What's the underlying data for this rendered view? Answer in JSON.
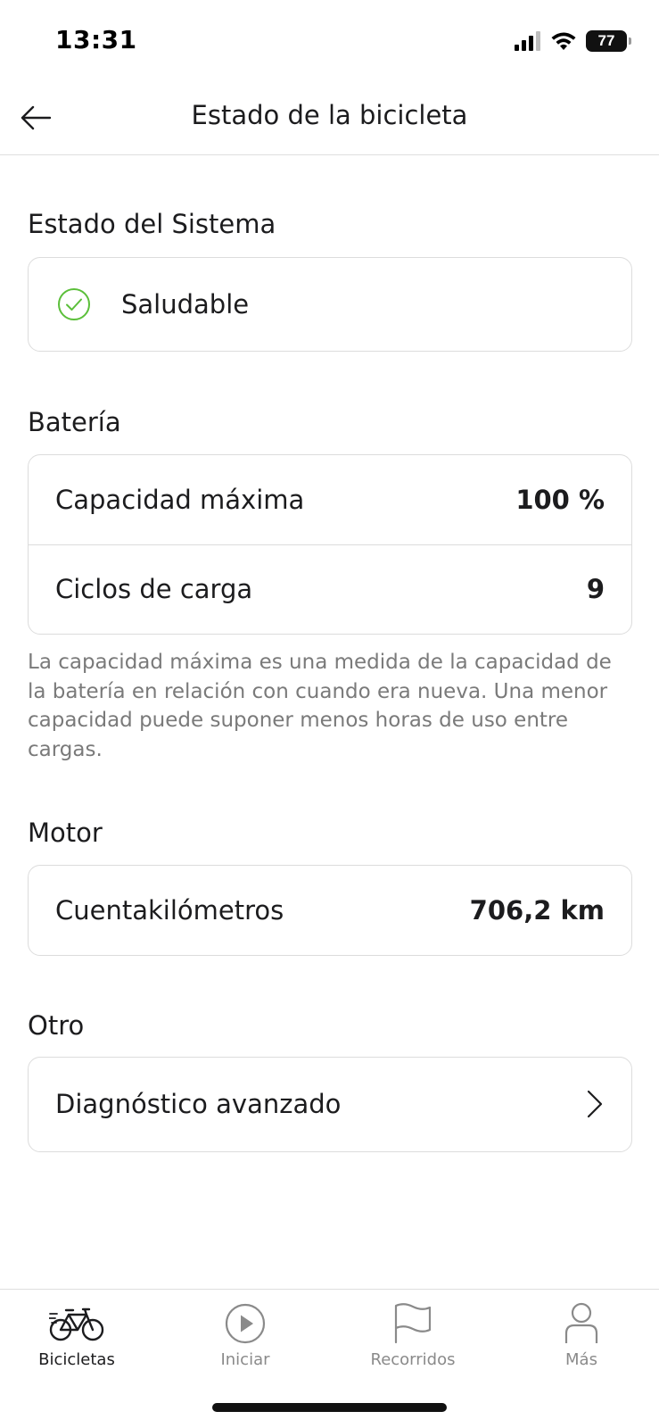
{
  "status_bar": {
    "time": "13:31",
    "battery_level": "77",
    "icons": [
      "cellular-signal-icon",
      "wifi-icon",
      "battery-icon"
    ]
  },
  "header": {
    "title": "Estado de la bicicleta",
    "back_icon": "arrow-left-icon"
  },
  "system": {
    "section_title": "Estado del Sistema",
    "status_label": "Saludable",
    "status_icon": "check-circle-icon",
    "status_color": "#5bbf3a"
  },
  "battery": {
    "section_title": "Batería",
    "rows": [
      {
        "label": "Capacidad máxima",
        "value": "100 %"
      },
      {
        "label": "Ciclos de carga",
        "value": "9"
      }
    ],
    "note": "La capacidad máxima es una medida de la capacidad de la batería en relación con cuando era nueva. Una menor capacidad puede suponer menos horas de uso entre cargas."
  },
  "motor": {
    "section_title": "Motor",
    "rows": [
      {
        "label": "Cuentakilómetros",
        "value": "706,2 km"
      }
    ]
  },
  "other": {
    "section_title": "Otro",
    "rows": [
      {
        "label": "Diagnóstico avanzado",
        "icon": "chevron-right-icon"
      }
    ]
  },
  "tab_bar": {
    "active": "Bicicletas",
    "tabs": [
      {
        "label": "Bicicletas",
        "icon": "bicycle-icon"
      },
      {
        "label": "Iniciar",
        "icon": "play-circle-icon"
      },
      {
        "label": "Recorridos",
        "icon": "flag-icon"
      },
      {
        "label": "Más",
        "icon": "person-icon"
      }
    ]
  }
}
